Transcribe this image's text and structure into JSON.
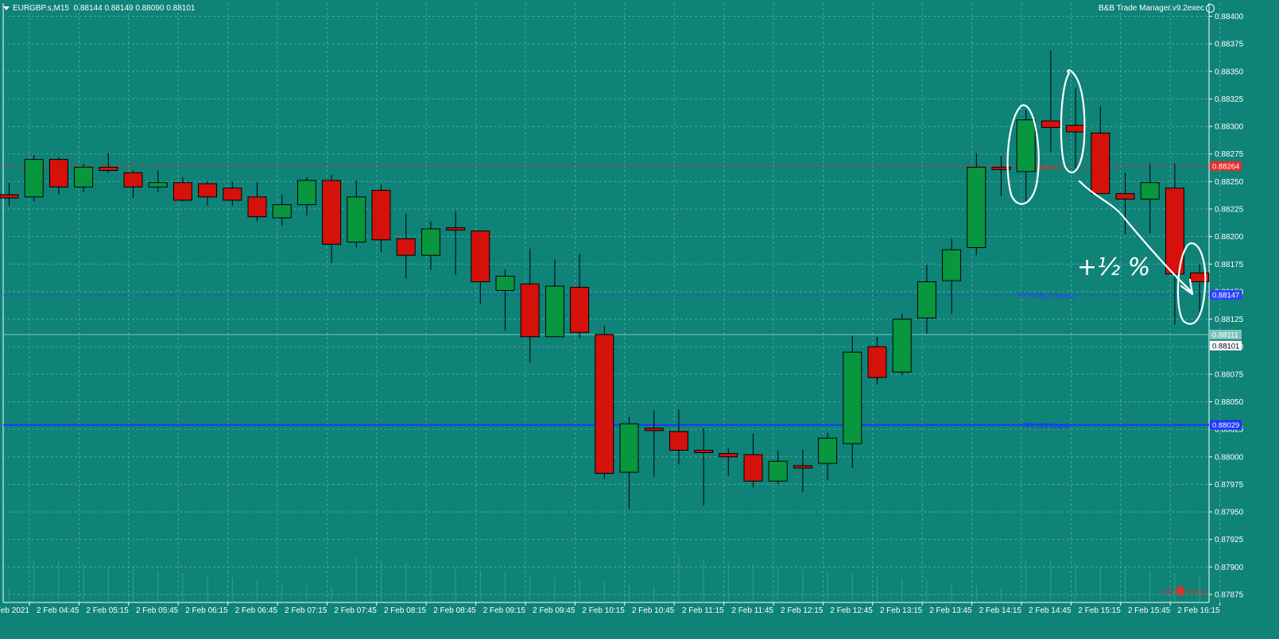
{
  "header": {
    "symbol": "EURGBP.s,M15",
    "ohlc": "0.88144 0.88149 0.88090 0.88101",
    "expert": "B&B Trade Manager.v9.2exec"
  },
  "colors": {
    "background": "#0f8378",
    "grid": "#5fb3aa",
    "bull": "#08963e",
    "bear": "#d4110b",
    "text": "#ffffff",
    "sl_line": "#e2302b",
    "tp1_line": "#2a42ff",
    "tp2_line": "#1b35ff"
  },
  "chart_data": {
    "type": "candlestick",
    "symbol": "EURGBP.s",
    "timeframe": "M15",
    "ylim": [
      0.87875,
      0.88412
    ],
    "y_ticks": [
      "0.88400",
      "0.88375",
      "0.88350",
      "0.88325",
      "0.88300",
      "0.88275",
      "0.88250",
      "0.88225",
      "0.88200",
      "0.88175",
      "0.88150",
      "0.88125",
      "0.88100",
      "0.88075",
      "0.88050",
      "0.88025",
      "0.88000",
      "0.87975",
      "0.87950",
      "0.87925",
      "0.87900",
      "0.87875"
    ],
    "x_labels": [
      "2 Feb 2021",
      "2 Feb 04:45",
      "2 Feb 05:15",
      "2 Feb 05:45",
      "2 Feb 06:15",
      "2 Feb 06:45",
      "2 Feb 07:15",
      "2 Feb 07:45",
      "2 Feb 08:15",
      "2 Feb 08:45",
      "2 Feb 09:15",
      "2 Feb 09:45",
      "2 Feb 10:15",
      "2 Feb 10:45",
      "2 Feb 11:15",
      "2 Feb 11:45",
      "2 Feb 12:15",
      "2 Feb 12:45",
      "2 Feb 13:15",
      "2 Feb 13:45",
      "2 Feb 14:15",
      "2 Feb 14:45",
      "2 Feb 15:15",
      "2 Feb 15:45",
      "2 Feb 16:15"
    ],
    "candles": [
      {
        "o": 0.88238,
        "h": 0.88249,
        "l": 0.88228,
        "c": 0.88235
      },
      {
        "o": 0.88236,
        "h": 0.88274,
        "l": 0.88232,
        "c": 0.8827
      },
      {
        "o": 0.8827,
        "h": 0.88272,
        "l": 0.88238,
        "c": 0.88245
      },
      {
        "o": 0.88245,
        "h": 0.88266,
        "l": 0.8824,
        "c": 0.88263
      },
      {
        "o": 0.88263,
        "h": 0.88276,
        "l": 0.88258,
        "c": 0.8826
      },
      {
        "o": 0.88258,
        "h": 0.8826,
        "l": 0.88235,
        "c": 0.88245
      },
      {
        "o": 0.88245,
        "h": 0.8826,
        "l": 0.8824,
        "c": 0.88249
      },
      {
        "o": 0.88249,
        "h": 0.88254,
        "l": 0.88232,
        "c": 0.88233
      },
      {
        "o": 0.88248,
        "h": 0.8825,
        "l": 0.88228,
        "c": 0.88236
      },
      {
        "o": 0.88244,
        "h": 0.8825,
        "l": 0.88228,
        "c": 0.88233
      },
      {
        "o": 0.88236,
        "h": 0.8825,
        "l": 0.88214,
        "c": 0.88218
      },
      {
        "o": 0.88217,
        "h": 0.88238,
        "l": 0.8821,
        "c": 0.88229
      },
      {
        "o": 0.88229,
        "h": 0.88254,
        "l": 0.88219,
        "c": 0.88251
      },
      {
        "o": 0.88251,
        "h": 0.88256,
        "l": 0.88176,
        "c": 0.88193
      },
      {
        "o": 0.88195,
        "h": 0.88251,
        "l": 0.8819,
        "c": 0.88236
      },
      {
        "o": 0.88242,
        "h": 0.88247,
        "l": 0.88186,
        "c": 0.88197
      },
      {
        "o": 0.88198,
        "h": 0.88221,
        "l": 0.88162,
        "c": 0.88183
      },
      {
        "o": 0.88183,
        "h": 0.88214,
        "l": 0.8817,
        "c": 0.88207
      },
      {
        "o": 0.88208,
        "h": 0.88223,
        "l": 0.88165,
        "c": 0.88206
      },
      {
        "o": 0.88205,
        "h": 0.88205,
        "l": 0.88139,
        "c": 0.88159
      },
      {
        "o": 0.88151,
        "h": 0.8817,
        "l": 0.88115,
        "c": 0.88164
      },
      {
        "o": 0.88157,
        "h": 0.88189,
        "l": 0.88086,
        "c": 0.88109
      },
      {
        "o": 0.88109,
        "h": 0.88179,
        "l": 0.88109,
        "c": 0.88155
      },
      {
        "o": 0.88154,
        "h": 0.88184,
        "l": 0.88108,
        "c": 0.88113
      },
      {
        "o": 0.88111,
        "h": 0.88119,
        "l": 0.8798,
        "c": 0.87985
      },
      {
        "o": 0.87986,
        "h": 0.88036,
        "l": 0.87953,
        "c": 0.8803
      },
      {
        "o": 0.88026,
        "h": 0.88042,
        "l": 0.87982,
        "c": 0.88024
      },
      {
        "o": 0.88023,
        "h": 0.88043,
        "l": 0.87993,
        "c": 0.88006
      },
      {
        "o": 0.88006,
        "h": 0.88026,
        "l": 0.87956,
        "c": 0.88005
      },
      {
        "o": 0.88003,
        "h": 0.88008,
        "l": 0.87983,
        "c": 0.88
      },
      {
        "o": 0.88002,
        "h": 0.88021,
        "l": 0.87972,
        "c": 0.87978
      },
      {
        "o": 0.87978,
        "h": 0.88006,
        "l": 0.87975,
        "c": 0.87996
      },
      {
        "o": 0.87992,
        "h": 0.88007,
        "l": 0.87968,
        "c": 0.8799
      },
      {
        "o": 0.87994,
        "h": 0.88022,
        "l": 0.87979,
        "c": 0.88017
      },
      {
        "o": 0.88012,
        "h": 0.8811,
        "l": 0.8799,
        "c": 0.88095
      },
      {
        "o": 0.881,
        "h": 0.88109,
        "l": 0.88066,
        "c": 0.88072
      },
      {
        "o": 0.88077,
        "h": 0.8813,
        "l": 0.88074,
        "c": 0.88125
      },
      {
        "o": 0.88126,
        "h": 0.88174,
        "l": 0.88112,
        "c": 0.88159
      },
      {
        "o": 0.8816,
        "h": 0.88198,
        "l": 0.8813,
        "c": 0.88188
      },
      {
        "o": 0.8819,
        "h": 0.88276,
        "l": 0.88183,
        "c": 0.88263
      },
      {
        "o": 0.88263,
        "h": 0.88273,
        "l": 0.88237,
        "c": 0.88261
      },
      {
        "o": 0.88259,
        "h": 0.88315,
        "l": 0.88232,
        "c": 0.88306
      },
      {
        "o": 0.88305,
        "h": 0.88369,
        "l": 0.88277,
        "c": 0.88299
      },
      {
        "o": 0.88301,
        "h": 0.88335,
        "l": 0.88262,
        "c": 0.88295
      },
      {
        "o": 0.88294,
        "h": 0.88318,
        "l": 0.8824,
        "c": 0.88239
      },
      {
        "o": 0.88239,
        "h": 0.88258,
        "l": 0.88202,
        "c": 0.88234
      },
      {
        "o": 0.88234,
        "h": 0.88266,
        "l": 0.88203,
        "c": 0.88249
      },
      {
        "o": 0.88244,
        "h": 0.88266,
        "l": 0.8812,
        "c": 0.88166
      },
      {
        "o": 0.88167,
        "h": 0.88175,
        "l": 0.88132,
        "c": 0.88159
      }
    ],
    "levels": [
      {
        "name": "sl",
        "price": 0.88264,
        "color": "#e2302b",
        "style": "dashed",
        "label": "SL (0.9pips)",
        "tag": "0.88264"
      },
      {
        "name": "tp1",
        "price": 0.88147,
        "color": "#2a42ff",
        "style": "dashdot",
        "label": "TP1 B/E(11.6pips)",
        "tag": "0.88147"
      },
      {
        "name": "current",
        "price": 0.88111,
        "color": "#7fc4bc",
        "style": "solid",
        "label": "",
        "tag": "0.88111"
      },
      {
        "name": "tp2",
        "price": 0.88029,
        "color": "#1b35ff",
        "style": "solid",
        "label": "TP2 (23.6pips)",
        "tag": "0.88029"
      }
    ],
    "bid_tag": "0.88101",
    "timer_text": "(16min 03:30)",
    "annotation_text": "+½ %"
  }
}
